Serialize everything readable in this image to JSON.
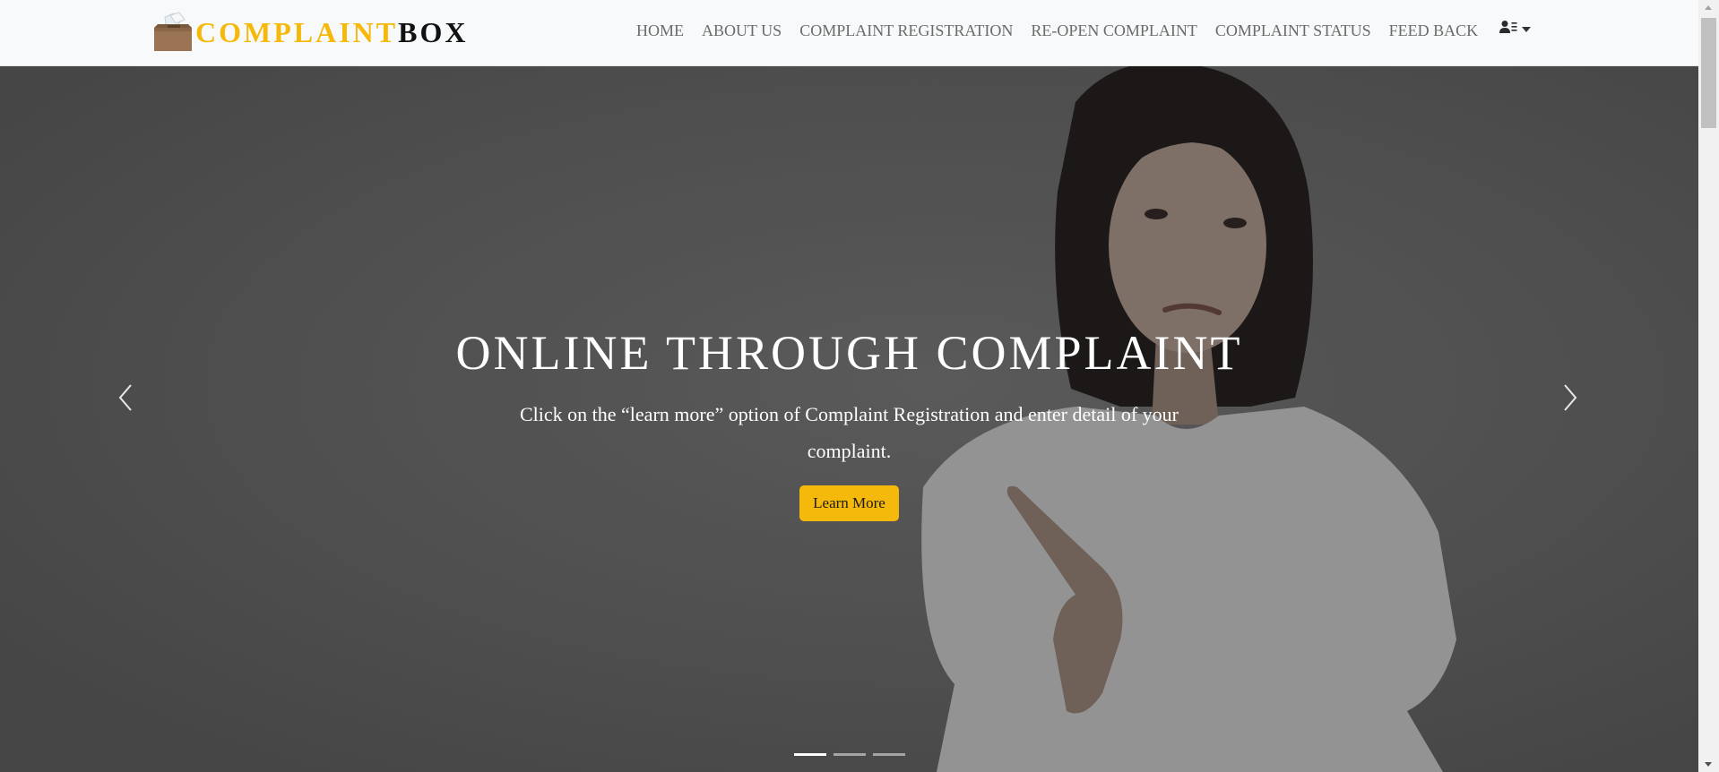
{
  "brand": {
    "word_1": "COMPLAINT",
    "word_2": "BOX",
    "logo_icon": "ballot-box-icon"
  },
  "nav": {
    "items": [
      {
        "label": "HOME"
      },
      {
        "label": "ABOUT US"
      },
      {
        "label": "COMPLAINT REGISTRATION"
      },
      {
        "label": "RE-OPEN COMPLAINT"
      },
      {
        "label": "COMPLAINT STATUS"
      },
      {
        "label": "FEED BACK"
      }
    ],
    "user_menu_icon": "user-list-icon"
  },
  "hero": {
    "title": "ONLINE THROUGH COMPLAINT",
    "text": "Click on the “learn more” option of Complaint Registration and enter detail of your complaint.",
    "button_label": "Learn More",
    "prev_icon": "chevron-left-icon",
    "next_icon": "chevron-right-icon",
    "slide_count": 3,
    "active_slide": 1
  },
  "colors": {
    "accent": "#f4b90b",
    "navbar_bg": "#f8f9fa",
    "nav_text": "#6b6b6b"
  }
}
